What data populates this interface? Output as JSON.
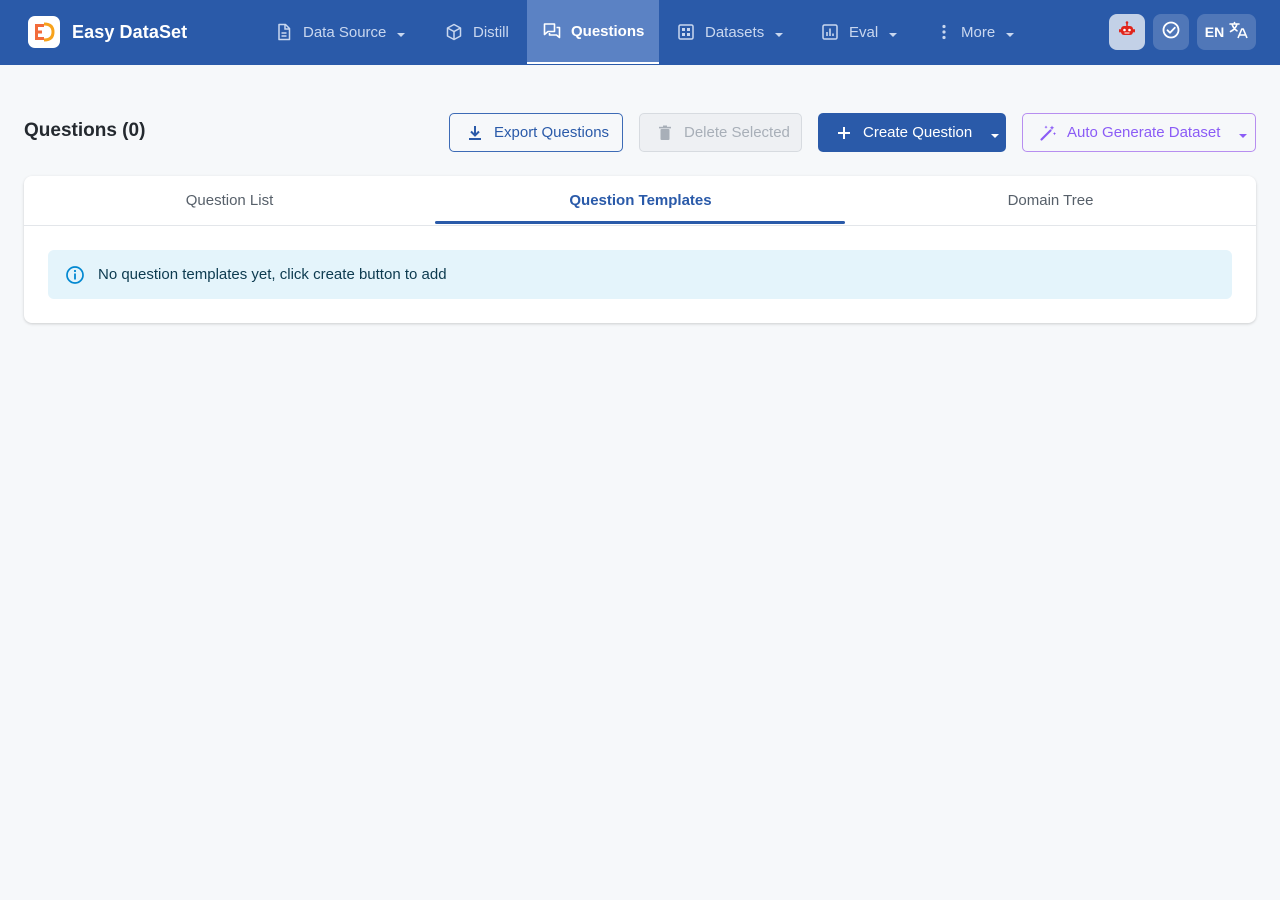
{
  "app": {
    "name": "Easy DataSet"
  },
  "nav": {
    "items": [
      {
        "label": "Data Source",
        "icon": "document-icon",
        "has_dropdown": true
      },
      {
        "label": "Distill",
        "icon": "cube-icon",
        "has_dropdown": false
      },
      {
        "label": "Questions",
        "icon": "chat-icon",
        "has_dropdown": false,
        "active": true
      },
      {
        "label": "Datasets",
        "icon": "grid-icon",
        "has_dropdown": true
      },
      {
        "label": "Eval",
        "icon": "bar-chart-icon",
        "has_dropdown": true
      },
      {
        "label": "More",
        "icon": "more-vertical-icon",
        "has_dropdown": true
      }
    ],
    "language": "EN"
  },
  "page": {
    "title": "Questions (0)"
  },
  "toolbar": {
    "export_label": "Export Questions",
    "delete_label": "Delete Selected",
    "create_label": "Create Question",
    "auto_label": "Auto Generate Dataset"
  },
  "tabs": [
    {
      "label": "Question List"
    },
    {
      "label": "Question Templates",
      "active": true
    },
    {
      "label": "Domain Tree"
    }
  ],
  "alert": {
    "message": "No question templates yet, click create button to add"
  },
  "colors": {
    "primary": "#2a5aa9",
    "background": "#f6f8fa",
    "accent_purple": "#8b5cf6",
    "info_bg": "#e4f4fb",
    "info_icon": "#0288d1"
  }
}
